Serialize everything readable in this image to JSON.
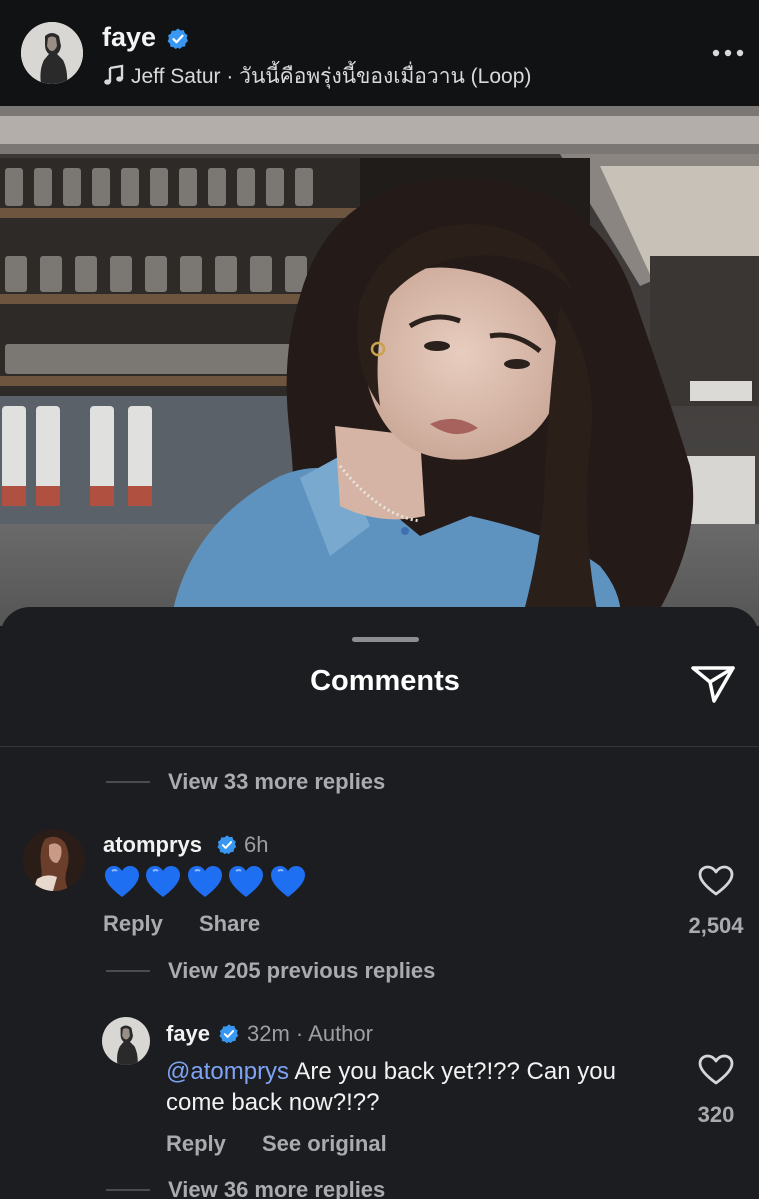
{
  "post": {
    "username": "faye",
    "music": "Jeff Satur · วันนี้คือพรุ่งนี้ของเมื่อวาน (Loop)",
    "icons": {
      "more": "more-horizontal-icon",
      "music": "music-note-icon",
      "verified": "verified-badge-icon"
    }
  },
  "sheet": {
    "title": "Comments",
    "share_icon": "send-icon"
  },
  "thread_top": {
    "view_more": "View 33 more replies"
  },
  "comment": {
    "username": "atomprys",
    "time": "6h",
    "emoji_text": "💙💙💙💙💙",
    "hearts_count": 5,
    "heart_color": "#1f6ff2",
    "reply": "Reply",
    "share": "Share",
    "likes": "2,504",
    "view_previous": "View 205 previous replies"
  },
  "reply": {
    "username": "faye",
    "time": "32m",
    "separator": "·",
    "author_tag": "Author",
    "mention": "@atomprys",
    "text": " Are you back yet?!?? Can you come back now?!??",
    "reply": "Reply",
    "see_original": "See original",
    "likes": "320",
    "view_more": "View 36 more replies"
  },
  "colors": {
    "background": "#1b1d20",
    "header": "#101214",
    "verified": "#3897f0",
    "mention": "#7ea3f2",
    "muted": "#a9abae"
  }
}
